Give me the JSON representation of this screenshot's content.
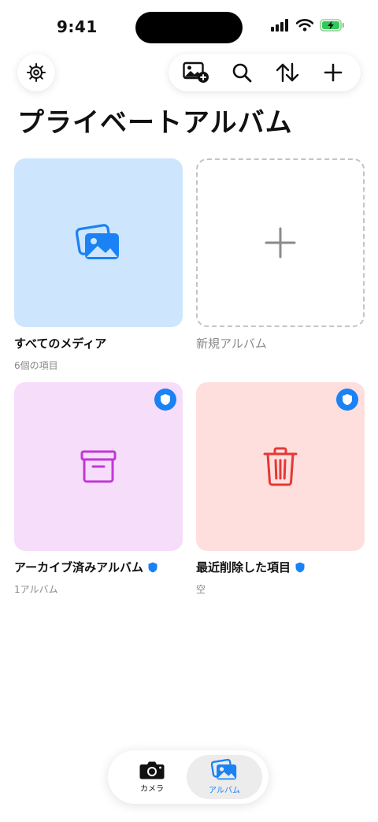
{
  "status_bar": {
    "time": "9:41"
  },
  "header": {
    "settings_icon": "gear-icon",
    "toolbar_icons": [
      "add-photo-icon",
      "search-icon",
      "sort-icon",
      "plus-icon"
    ]
  },
  "page": {
    "title": "プライベートアルバム"
  },
  "albums": [
    {
      "name": "すべてのメディア",
      "subtitle": "6個の項目",
      "tile_color": "#cde6fd",
      "icon": "photos-icon",
      "icon_color": "#1a82f5",
      "protected": false
    },
    {
      "name": "新規アルバム",
      "subtitle": "",
      "icon": "plus-icon",
      "protected": false
    },
    {
      "name": "アーカイブ済みアルバム",
      "subtitle": "1アルバム",
      "tile_color": "#f6ddfa",
      "icon": "archive-box-icon",
      "icon_color": "#c237d6",
      "protected": true
    },
    {
      "name": "最近削除した項目",
      "subtitle": "空",
      "tile_color": "#ffdede",
      "icon": "trash-icon",
      "icon_color": "#e53935",
      "protected": true
    }
  ],
  "accent_color": "#1a82f5",
  "tab_bar": {
    "tabs": [
      {
        "label": "カメラ",
        "icon": "camera-icon",
        "selected": false
      },
      {
        "label": "アルバム",
        "icon": "photos-icon",
        "selected": true
      }
    ]
  }
}
